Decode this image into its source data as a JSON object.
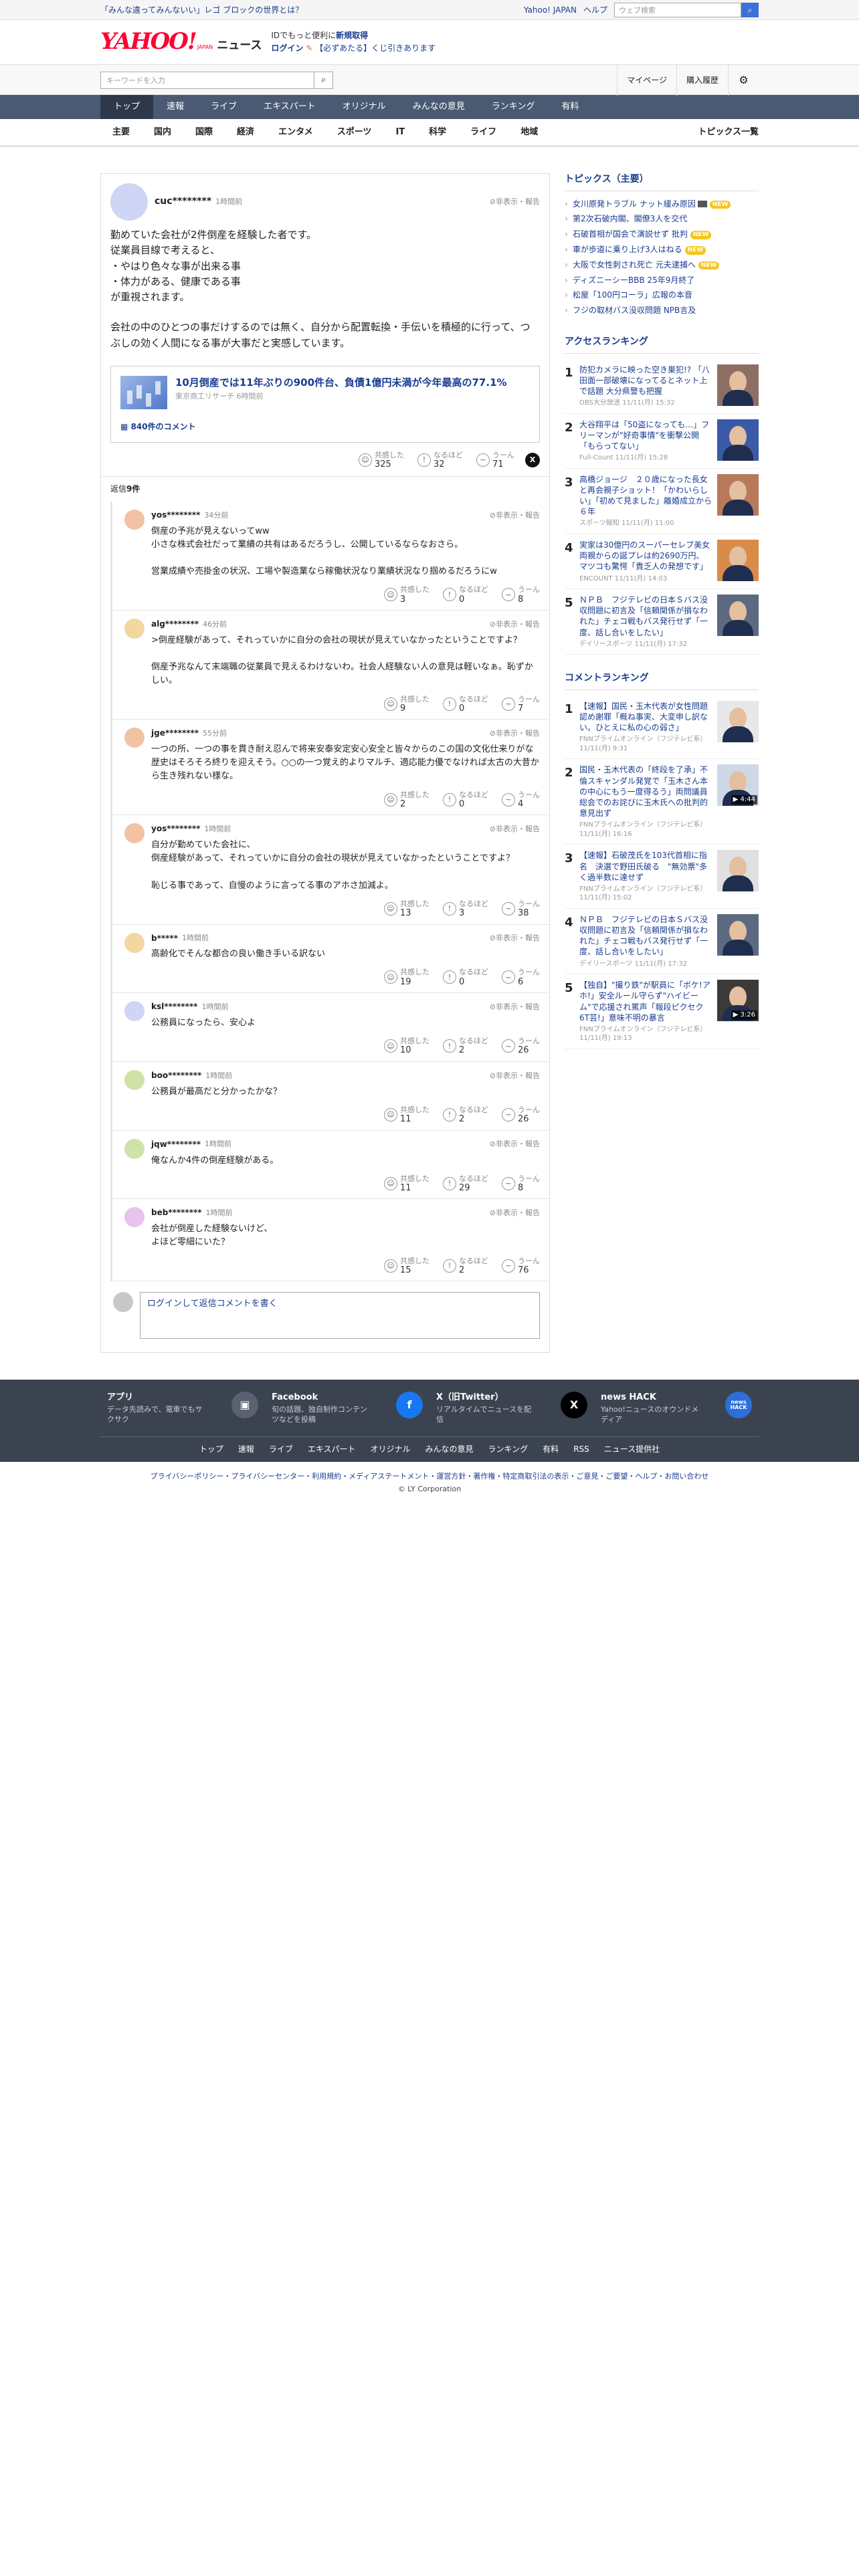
{
  "promo": {
    "link": "「みんな違ってみんないい」レゴ ブロックの世界とは？",
    "links": [
      "Yahoo! JAPAN",
      "ヘルプ"
    ],
    "search_placeholder": "ウェブ検索"
  },
  "masthead": {
    "logo": "YAHOO!",
    "logo_sub": "JAPAN",
    "news": "ニュース",
    "msg_line1_a": "IDでもっと便利に",
    "msg_line1_b": "新規取得",
    "msg_line2_a": "ログイン",
    "msg_line2_b": "【必ずあたる】くじ引きあります"
  },
  "search": {
    "placeholder": "キーワードを入力",
    "mypage": "マイページ",
    "history": "購入履歴"
  },
  "main_nav": [
    "トップ",
    "速報",
    "ライブ",
    "エキスパート",
    "オリジナル",
    "みんなの意見",
    "ランキング",
    "有料"
  ],
  "sub_nav": [
    "主要",
    "国内",
    "国際",
    "経済",
    "エンタメ",
    "スポーツ",
    "IT",
    "科学",
    "ライフ",
    "地域"
  ],
  "sub_nav_right": "トピックス一覧",
  "parent_comment": {
    "user": "cuc********",
    "time": "1時間前",
    "report": "非表示・報告",
    "body1": "勤めていた会社が2件倒産を経験した者です。\n従業員目線で考えると、\n・やはり色々な事が出来る事\n・体力がある、健康である事\nが重視されます。",
    "body2": "会社の中のひとつの事だけするのでは無く、自分から配置転換・手伝いを積極的に行って、つぶしの効く人間になる事が大事だと実感しています。",
    "article": {
      "title": "10月倒産では11年ぶりの900件台、負債1億円未満が今年最高の77.1%",
      "meta": "東京商工リサーチ 6時間前",
      "comment_count": "840件のコメント"
    },
    "reactions": {
      "agree_label": "共感した",
      "agree": "325",
      "naruhodo_label": "なるほど",
      "naruhodo": "32",
      "uun_label": "うーん",
      "uun": "71"
    }
  },
  "replies_label": "返信",
  "replies_count": "9件",
  "replies": [
    {
      "user": "yos********",
      "time": "34分前",
      "color": "#f2c2a5",
      "text": "倒産の予兆が見えないってww\n小さな株式会社だって業績の共有はあるだろうし、公開しているならなおさら。\n\n営業成績や売掛金の状況、工場や製造業なら稼働状況なり業績状況なり掴めるだろうにw",
      "agree": "3",
      "naruhodo": "0",
      "uun": "8"
    },
    {
      "user": "alg********",
      "time": "46分前",
      "color": "#f2d8a0",
      "text": ">倒産経験があって、それっていかに自分の会社の現状が見えていなかったということですよ？\n\n倒産予兆なんて末端職の従業員で見えるわけないわ。社会人経験ない人の意見は軽いなぁ。恥ずかしい。",
      "agree": "9",
      "naruhodo": "0",
      "uun": "7"
    },
    {
      "user": "jge********",
      "time": "55分前",
      "color": "#f2c2a5",
      "text": "一つの所、一つの事を貫き耐え忍んで将来安泰安定安心安全と皆々からのこの国の文化仕来りがな歴史はそろそろ終りを迎えそう。○○の一つ覚え的よりマルチ、適応能力優でなければ太古の大昔から生き残れない様な。",
      "agree": "2",
      "naruhodo": "0",
      "uun": "4"
    },
    {
      "user": "yos********",
      "time": "1時間前",
      "color": "#f2c2a5",
      "text": "自分が勤めていた会社に、\n倒産経験があって、それっていかに自分の会社の現状が見えていなかったということですよ？\n\n恥じる事であって、自慢のように言ってる事のアホさ加減よ。",
      "agree": "13",
      "naruhodo": "3",
      "uun": "38"
    },
    {
      "user": "b*****",
      "time": "1時間前",
      "color": "#f2d8a0",
      "text": "高齢化でそんな都合の良い働き手いる訳ない",
      "agree": "19",
      "naruhodo": "0",
      "uun": "6"
    },
    {
      "user": "ksl********",
      "time": "1時間前",
      "color": "#cfd6f5",
      "text": "公務員になったら、安心よ",
      "agree": "10",
      "naruhodo": "2",
      "uun": "26"
    },
    {
      "user": "boo********",
      "time": "1時間前",
      "color": "#cfe3a8",
      "text": "公務員が最高だと分かったかな？",
      "agree": "11",
      "naruhodo": "2",
      "uun": "26"
    },
    {
      "user": "jqw********",
      "time": "1時間前",
      "color": "#cfe3a8",
      "text": "俺なんか4件の倒産経験がある。",
      "agree": "11",
      "naruhodo": "29",
      "uun": "8"
    },
    {
      "user": "beb********",
      "time": "1時間前",
      "color": "#e6c4ee",
      "text": "会社が倒産した経験ないけど、\nよほど零細にいた？",
      "agree": "15",
      "naruhodo": "2",
      "uun": "76"
    }
  ],
  "write_box": {
    "login": "ログイン",
    "rest": "して返信コメントを書く"
  },
  "sidebar": {
    "topics_title": "トピックス（主要）",
    "topics": [
      {
        "text": "女川原発トラブル ナット緩み原因",
        "badge": "new",
        "cam": true
      },
      {
        "text": "第2次石破内閣、閣僚3人を交代",
        "badge": "",
        "cam": false
      },
      {
        "text": "石破首相が国会で演説せず 批判",
        "badge": "new",
        "cam": false
      },
      {
        "text": "車が歩道に乗り上げ3人はねる",
        "badge": "new",
        "cam": false
      },
      {
        "text": "大阪で女性刺され死亡 元夫逮捕へ",
        "badge": "new",
        "cam": false
      },
      {
        "text": "ディズニーシーBBB 25年9月終了",
        "badge": "",
        "cam": false
      },
      {
        "text": "松屋「100円コーラ」広報の本音",
        "badge": "",
        "cam": false
      },
      {
        "text": "フジの取材バス没収問題 NPB言及",
        "badge": "",
        "cam": false
      }
    ],
    "new_label": "NEW",
    "access_title": "アクセスランキング",
    "access": [
      {
        "rank": "1",
        "text": "防犯カメラに映った空き巣犯!? 「八田面一部破壊になってるとネット上で話題 大分県警も把握",
        "src": "OBS大分放送 11/11(月) 15:32",
        "bg": "#8d6e63"
      },
      {
        "rank": "2",
        "text": "大谷翔平は「50盗になっても…」フリーマンが\"好奇事情\"を衝撃公開「もらってない」",
        "src": "Full-Count 11/11(月) 15:28",
        "bg": "#3a5aa8"
      },
      {
        "rank": "3",
        "text": "高橋ジョージ　２０歳になった長女と再会親子ショット！「かわいらしい」「初めて見ました」離婚成立から６年",
        "src": "スポーツ報知 11/11(月) 11:00",
        "bg": "#b87a5a"
      },
      {
        "rank": "4",
        "text": "実家は30億円のスーパーセレブ美女　両親からの誕プレは約2690万円、マツコも驚愕「貴乏人の発想です」",
        "src": "ENCOUNT 11/11(月) 14:03",
        "bg": "#d98c4a"
      },
      {
        "rank": "5",
        "text": "ＮＰＢ　フジテレビの日本Ｓバス没収問題に初言及「信頼関係が損なわれた」チェコ戦もバス発行せず「一度、話し合いをしたい」",
        "src": "デイリースポーツ 11/11(月) 17:32",
        "bg": "#5b6a80"
      }
    ],
    "comment_title": "コメントランキング",
    "comment": [
      {
        "rank": "1",
        "text": "【速報】国民・玉木代表が女性問題認め謝罪「概ね事実、大変申し訳ない。ひとえに私の心の弱さ」",
        "src": "FNNプライムオンライン（フジテレビ系） 11/11(月) 9:31",
        "bg": "#e8e8e8",
        "dur": ""
      },
      {
        "rank": "2",
        "text": "国民・玉木代表の「終段を了承」不倫スキャンダル発覚で「玉木さん本の中心にもう一度得るう」両問議員総会でのお詫びに玉木氏への批判的意見出ず",
        "src": "FNNプライムオンライン（フジテレビ系） 11/11(月) 16:16",
        "bg": "#cfd8e6",
        "dur": "▶ 4:44"
      },
      {
        "rank": "3",
        "text": "【速報】石破茂氏を103代首相に指名　決選で野田氏破る　\"無効票\"多く過半数に達せず",
        "src": "FNNプライムオンライン（フジテレビ系） 11/11(月) 15:02",
        "bg": "#e0e0e0",
        "dur": ""
      },
      {
        "rank": "4",
        "text": "ＮＰＢ　フジテレビの日本Ｓバス没収問題に初言及「信頼関係が損なわれた」チェコ戦もバス発行せず「一度、話し合いをしたい」",
        "src": "デイリースポーツ 11/11(月) 17:32",
        "bg": "#5b6a80",
        "dur": ""
      },
      {
        "rank": "5",
        "text": "【独自】\"撮り鉄\"が駅員に「ボケ!アホ!」安全ルール守らず\"ハイビーム\"で応援され罵声「報段ピクセク6T芸!」意味不明の暴言",
        "src": "FNNプライムオンライン（フジテレビ系） 11/11(月) 19:13",
        "bg": "#3a3a3a",
        "dur": "▶ 3:26"
      }
    ]
  },
  "footer": {
    "apps": [
      {
        "title": "アプリ",
        "desc": "データ先読みで、電車でもサクサク",
        "icon": "▣",
        "color": "#5a6170"
      },
      {
        "title": "Facebook",
        "desc": "旬の話題、独自制作コンテンツなどを投稿",
        "icon": "f",
        "color": "#1877f2"
      },
      {
        "title": "X（旧Twitter）",
        "desc": "リアルタイムでニュースを配信",
        "icon": "X",
        "color": "#000000"
      },
      {
        "title": "news HACK",
        "desc": "Yahoo!ニュースのオウンドメディア",
        "icon": "news HACK",
        "color": "#2d6fd8"
      }
    ],
    "nav": [
      "トップ",
      "速報",
      "ライブ",
      "エキスパート",
      "オリジナル",
      "みんなの意見",
      "ランキング",
      "有料",
      "RSS",
      "ニュース提供社"
    ],
    "links": "プライバシーポリシー・プライバシーセンター・利用規約・メディアステートメント・運営方針・著作権・特定商取引法の表示・ご意見・ご要望・ヘルプ・お問い合わせ",
    "copyright": "© LY Corporation"
  }
}
